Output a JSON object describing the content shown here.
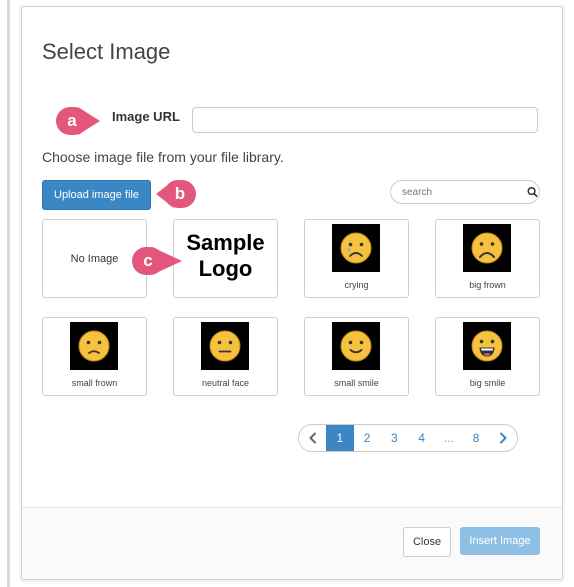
{
  "dialog": {
    "title": "Select Image",
    "url_label": "Image URL",
    "url_value": "",
    "choose_text": "Choose image file from your file library.",
    "upload_label": "Upload image file",
    "search_placeholder": "search"
  },
  "callouts": {
    "a": "a",
    "b": "b",
    "c": "c"
  },
  "tiles": [
    {
      "caption": "No Image"
    },
    {
      "logo_line1": "Sample",
      "logo_line2": "Logo"
    },
    {
      "caption": "crying",
      "icon": "crying-face-icon"
    },
    {
      "caption": "big frown",
      "icon": "big-frown-face-icon"
    },
    {
      "caption": "small frown",
      "icon": "small-frown-face-icon"
    },
    {
      "caption": "neutral face",
      "icon": "neutral-face-icon"
    },
    {
      "caption": "small smile",
      "icon": "small-smile-face-icon"
    },
    {
      "caption": "big smile",
      "icon": "big-smile-face-icon"
    }
  ],
  "pagination": {
    "pages": [
      "1",
      "2",
      "3",
      "4",
      "...",
      "8"
    ],
    "current": "1"
  },
  "footer": {
    "close_label": "Close",
    "insert_label": "Insert Image"
  },
  "colors": {
    "primary": "#3b86c4",
    "primary_disabled": "#8ec0e6",
    "callout": "#e4577d",
    "emoji_yellow": "#f6c23e"
  }
}
